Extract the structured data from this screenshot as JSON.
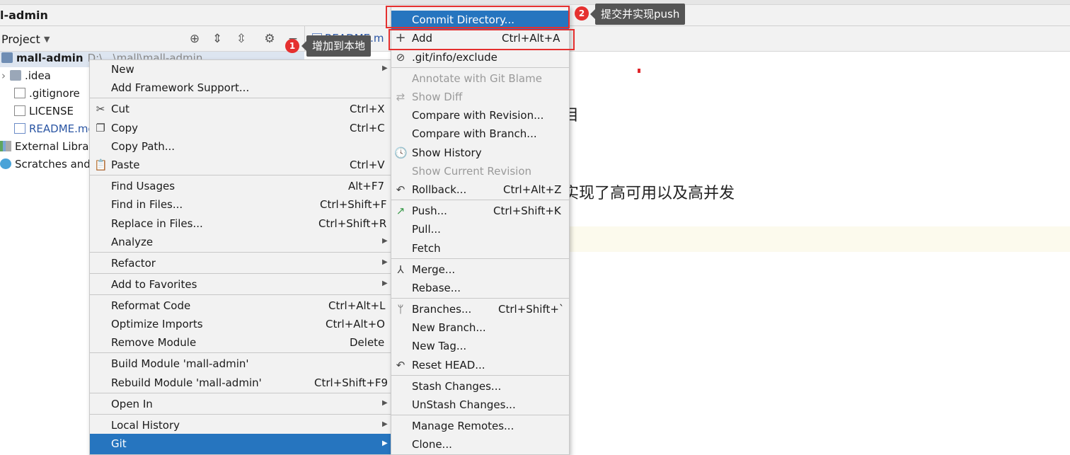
{
  "window": {
    "title": "l-admin"
  },
  "project_bar": {
    "label": "Project"
  },
  "editor": {
    "tab_label": "README.m",
    "line1": "目",
    "line2": "实现了高可用以及高并发"
  },
  "tree": {
    "items": [
      {
        "label": "mall-admin",
        "extra": "D:\\...\\mall\\mall-admin"
      },
      {
        "label": ".idea"
      },
      {
        "label": ".gitignore"
      },
      {
        "label": "LICENSE"
      },
      {
        "label": "README.mo"
      },
      {
        "label": "External Librari"
      },
      {
        "label": "Scratches and C"
      }
    ]
  },
  "main_menu": {
    "items": [
      {
        "label": "New"
      },
      {
        "label": "Add Framework Support..."
      },
      {
        "label": "Cut",
        "shortcut": "Ctrl+X"
      },
      {
        "label": "Copy",
        "shortcut": "Ctrl+C"
      },
      {
        "label": "Copy Path..."
      },
      {
        "label": "Paste",
        "shortcut": "Ctrl+V"
      },
      {
        "label": "Find Usages",
        "shortcut": "Alt+F7"
      },
      {
        "label": "Find in Files...",
        "shortcut": "Ctrl+Shift+F"
      },
      {
        "label": "Replace in Files...",
        "shortcut": "Ctrl+Shift+R"
      },
      {
        "label": "Analyze"
      },
      {
        "label": "Refactor"
      },
      {
        "label": "Add to Favorites"
      },
      {
        "label": "Reformat Code",
        "shortcut": "Ctrl+Alt+L"
      },
      {
        "label": "Optimize Imports",
        "shortcut": "Ctrl+Alt+O"
      },
      {
        "label": "Remove Module",
        "shortcut": "Delete"
      },
      {
        "label": "Build Module 'mall-admin'"
      },
      {
        "label": "Rebuild Module 'mall-admin'",
        "shortcut": "Ctrl+Shift+F9"
      },
      {
        "label": "Open In"
      },
      {
        "label": "Local History"
      },
      {
        "label": "Git"
      }
    ]
  },
  "git_menu": {
    "items": [
      {
        "label": "Commit Directory..."
      },
      {
        "label": "Add",
        "shortcut": "Ctrl+Alt+A"
      },
      {
        "label": ".git/info/exclude"
      },
      {
        "label": "Annotate with Git Blame"
      },
      {
        "label": "Show Diff"
      },
      {
        "label": "Compare with Revision..."
      },
      {
        "label": "Compare with Branch..."
      },
      {
        "label": "Show History"
      },
      {
        "label": "Show Current Revision"
      },
      {
        "label": "Rollback...",
        "shortcut": "Ctrl+Alt+Z"
      },
      {
        "label": "Push...",
        "shortcut": "Ctrl+Shift+K"
      },
      {
        "label": "Pull..."
      },
      {
        "label": "Fetch"
      },
      {
        "label": "Merge..."
      },
      {
        "label": "Rebase..."
      },
      {
        "label": "Branches...",
        "shortcut": "Ctrl+Shift+`"
      },
      {
        "label": "New Branch..."
      },
      {
        "label": "New Tag..."
      },
      {
        "label": "Reset HEAD..."
      },
      {
        "label": "Stash Changes..."
      },
      {
        "label": "UnStash Changes..."
      },
      {
        "label": "Manage Remotes..."
      },
      {
        "label": "Clone..."
      }
    ]
  },
  "annotations": [
    {
      "number": "1",
      "text": "增加到本地"
    },
    {
      "number": "2",
      "text": "提交并实现push"
    }
  ],
  "colors": {
    "selection": "#2675bf",
    "annotation": "#e5302f",
    "callout": "#555555"
  }
}
